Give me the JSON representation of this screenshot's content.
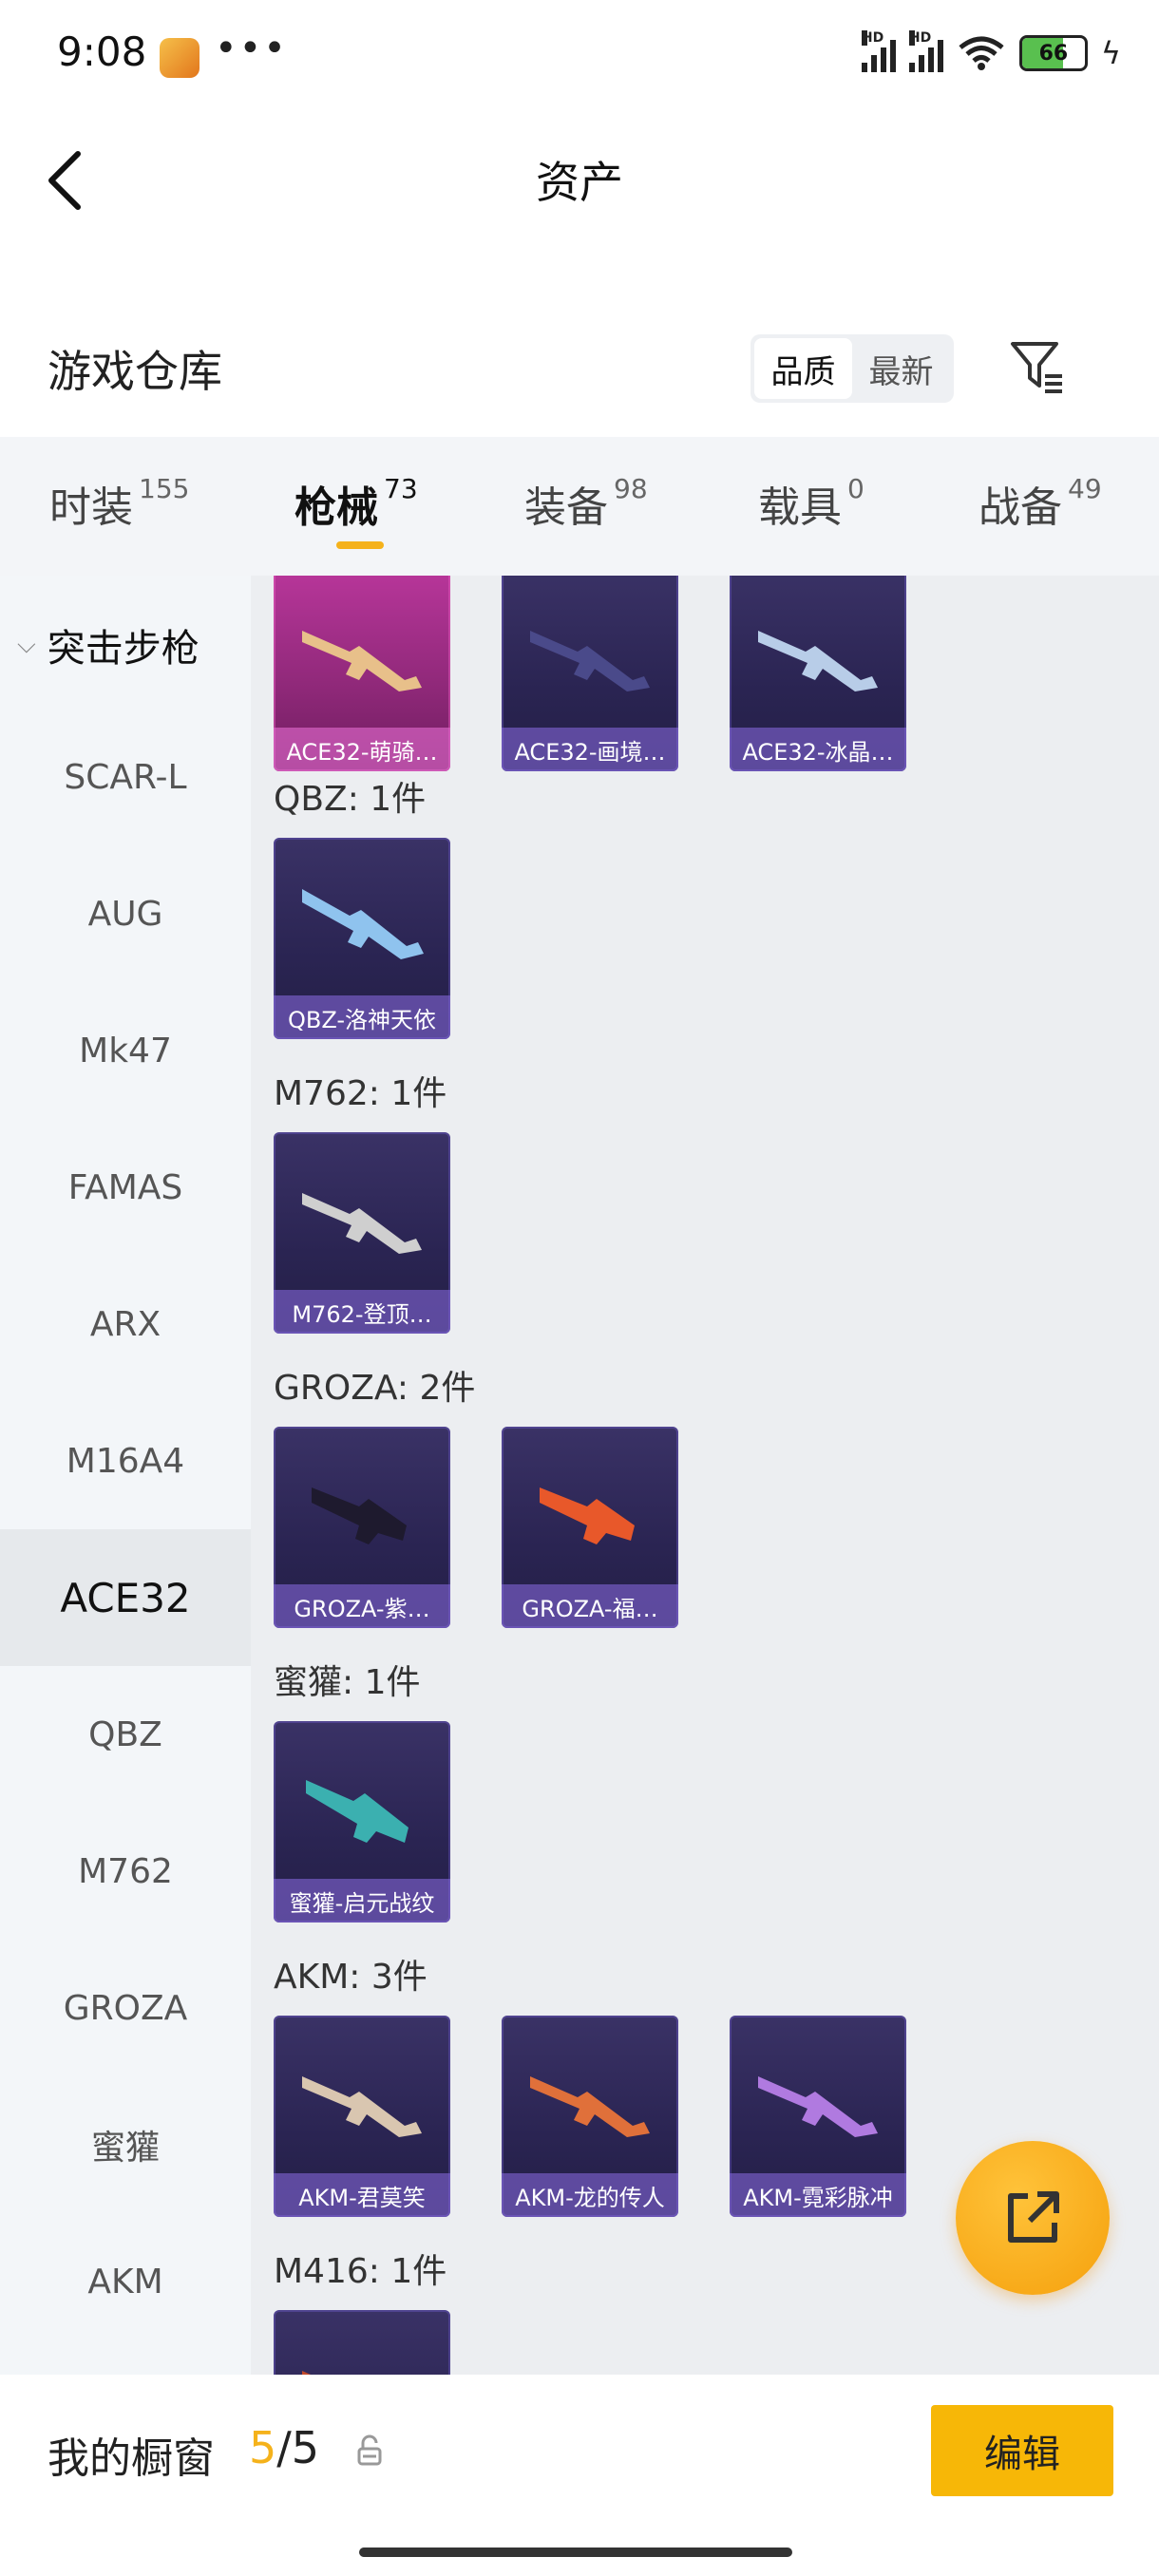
{
  "status_bar": {
    "time": "9:08",
    "dots": "•••",
    "battery": "66",
    "net_label_1": "HD",
    "net_label_2": "HD"
  },
  "header": {
    "title": "资产"
  },
  "warehouse": {
    "title": "游戏仓库",
    "sort_options": [
      "品质",
      "最新"
    ],
    "active_sort": "品质"
  },
  "tabs": [
    {
      "label": "时装",
      "count": "155"
    },
    {
      "label": "枪械",
      "count": "73"
    },
    {
      "label": "装备",
      "count": "98"
    },
    {
      "label": "载具",
      "count": "0"
    },
    {
      "label": "战备",
      "count": "49"
    }
  ],
  "sidebar": {
    "header": "突击步枪",
    "items": [
      "SCAR-L",
      "AUG",
      "Mk47",
      "FAMAS",
      "ARX",
      "M16A4",
      "ACE32",
      "QBZ",
      "M762",
      "GROZA",
      "蜜獾",
      "AKM"
    ],
    "active": "ACE32"
  },
  "groups": [
    {
      "label": "",
      "items": [
        "ACE32-萌骑…",
        "ACE32-画境…",
        "ACE32-冰晶…"
      ]
    },
    {
      "label": "QBZ: 1件",
      "items": [
        "QBZ-洛神天依"
      ]
    },
    {
      "label": "M762: 1件",
      "items": [
        "M762-登顶…"
      ]
    },
    {
      "label": "GROZA: 2件",
      "items": [
        "GROZA-紫…",
        "GROZA-福…"
      ]
    },
    {
      "label": "蜜獾: 1件",
      "items": [
        "蜜獾-启元战纹"
      ]
    },
    {
      "label": "AKM: 3件",
      "items": [
        "AKM-君莫笑",
        "AKM-龙的传人",
        "AKM-霓彩脉冲"
      ]
    },
    {
      "label": "M416: 1件",
      "items": [
        ""
      ]
    }
  ],
  "bottom": {
    "showcase_label": "我的橱窗",
    "showcase_current": "5",
    "showcase_sep": "/",
    "showcase_total": "5",
    "edit_label": "编辑"
  },
  "colors": {
    "accent": "#f5b21b",
    "card_bg": "#2a2452",
    "card_rare": "#b8369a"
  }
}
